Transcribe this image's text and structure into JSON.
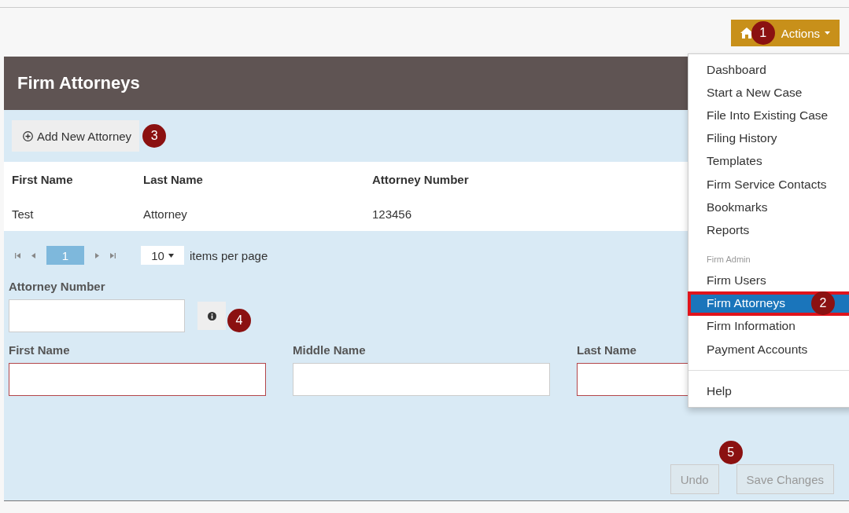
{
  "top_bar": {
    "actions_button": {
      "label": "Actions",
      "callout": "1"
    }
  },
  "panel": {
    "title": "Firm Attorneys",
    "add_button": {
      "label": "Add New Attorney",
      "callout": "3"
    },
    "table": {
      "columns": [
        "First Name",
        "Last Name",
        "Attorney Number"
      ],
      "rows": [
        [
          "Test",
          "Attorney",
          "123456"
        ]
      ]
    },
    "pager": {
      "pages": [
        {
          "label": "1",
          "selected": true
        }
      ],
      "page_size": "10",
      "page_size_label": "items per page"
    },
    "form": {
      "attorney_number": {
        "label": "Attorney Number",
        "callout": "4"
      },
      "fields": [
        {
          "label": "First Name",
          "invalid": true
        },
        {
          "label": "Middle Name",
          "invalid": false
        },
        {
          "label": "Last Name",
          "invalid": true
        }
      ],
      "buttons": [
        {
          "label": "Undo",
          "disabled": true
        },
        {
          "label": "Save Changes",
          "disabled": true,
          "callout": "5"
        }
      ]
    }
  },
  "menu": {
    "items": [
      {
        "kind": "item",
        "label": "Dashboard",
        "selected": false
      },
      {
        "kind": "item",
        "label": "Start a New Case",
        "selected": false
      },
      {
        "kind": "item",
        "label": "File Into Existing Case",
        "selected": false
      },
      {
        "kind": "item",
        "label": "Filing History",
        "selected": false
      },
      {
        "kind": "item",
        "label": "Templates",
        "selected": false
      },
      {
        "kind": "item",
        "label": "Firm Service Contacts",
        "selected": false
      },
      {
        "kind": "item",
        "label": "Bookmarks",
        "selected": false
      },
      {
        "kind": "item",
        "label": "Reports",
        "selected": false
      },
      {
        "kind": "header",
        "label": "Firm Admin"
      },
      {
        "kind": "item",
        "label": "Firm Users",
        "selected": false
      },
      {
        "kind": "item",
        "label": "Firm Attorneys",
        "selected": true,
        "callout": "2"
      },
      {
        "kind": "item",
        "label": "Firm Information",
        "selected": false
      },
      {
        "kind": "item",
        "label": "Payment Accounts",
        "selected": false
      },
      {
        "kind": "divider"
      },
      {
        "kind": "item",
        "label": "Help",
        "selected": false
      }
    ]
  }
}
